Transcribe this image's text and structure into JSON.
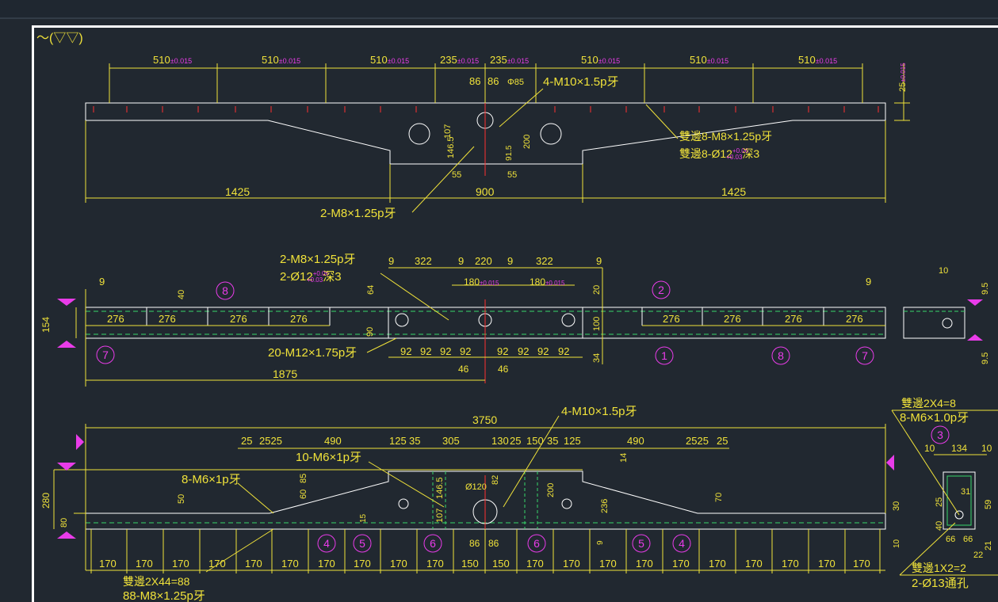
{
  "surface_mark": "～(▽▽)",
  "top_view": {
    "pitch": "510",
    "pitch_tol": "±0.015",
    "half_pitch": "235",
    "half_tol": "±0.015",
    "dim_86": "86",
    "dia_85": "Φ85",
    "callout_m10": "4-M10×1.5p牙",
    "thickness": "25",
    "thickness_tol": "±0.015",
    "dim_107": "107",
    "dim_146_5": "146.5",
    "dim_200": "200",
    "dim_91_5": "91.5",
    "dim_55": "55",
    "callout_m8_line1": "雙邊8-M8×1.25p牙",
    "callout_m8_line2": "雙邊8-Ø12",
    "tol_plus": "+0.06",
    "tol_minus": "+0.03",
    "depth_3": "深3",
    "len_1425": "1425",
    "len_900": "900",
    "callout_2m8": "2-M8×1.25p牙"
  },
  "middle_view": {
    "callout_line1": "2-M8×1.25p牙",
    "callout_line2": "2-Ø12",
    "tol_plus": "+0.06",
    "tol_minus": "+0.03",
    "depth": "深3",
    "d9": "9",
    "d322": "322",
    "d220": "220",
    "d180": "180",
    "tol_015": "±0.015",
    "d20": "20",
    "d64": "64",
    "d40": "40",
    "d154": "154",
    "d276": "276",
    "d90": "90",
    "d100": "100",
    "d34": "34",
    "d92": "92",
    "d46": "46",
    "callout_m12": "20-M12×1.75p牙",
    "len_1875": "1875",
    "d10": "10",
    "d9_5": "9.5",
    "balloons": [
      "8",
      "7",
      "2",
      "1",
      "8",
      "7"
    ]
  },
  "bottom_view": {
    "len_3750": "3750",
    "d25": "25",
    "d2525": "2525",
    "d490": "490",
    "d125": "125",
    "d35": "35",
    "d305": "305",
    "d130": "130",
    "d150": "150",
    "callout_m10": "4-M10×1.5p牙",
    "callout_10m6": "10-M6×1p牙",
    "callout_8m6": "8-M6×1p牙",
    "d280": "280",
    "d80": "80",
    "d50": "50",
    "d60": "60",
    "d85": "85",
    "d107": "107",
    "d146_5": "146.5",
    "dia_120": "Ø120",
    "d82": "82",
    "d200": "200",
    "d14": "14",
    "d236": "236",
    "d70": "70",
    "d30": "30",
    "d15": "15",
    "d9": "9",
    "d10": "10",
    "d170": "170",
    "d86": "86",
    "callout_bottom_line1": "雙邊2X44=88",
    "callout_bottom_line2": "88-M8×1.25p牙",
    "balloons": [
      "4",
      "5",
      "6",
      "6",
      "5",
      "4"
    ]
  },
  "side_detail": {
    "callout_line1": "雙邊2X4=8",
    "callout_line2": "8-M6×1.0p牙",
    "balloon": "3",
    "d10": "10",
    "d134": "134",
    "d31": "31",
    "d25": "25",
    "d59": "59",
    "d40": "40",
    "d66": "66",
    "d21": "21",
    "d22": "22",
    "callout_bottom_line1": "雙邊1X2=2",
    "callout_bottom_line2": "2-Ø13通孔"
  },
  "colors": {
    "background": "#212830",
    "outline": "#ffffff",
    "dimension": "#f0e23a",
    "annotation": "#37d66a",
    "marker": "#e93ce9",
    "hole_mark": "#ff3030"
  }
}
